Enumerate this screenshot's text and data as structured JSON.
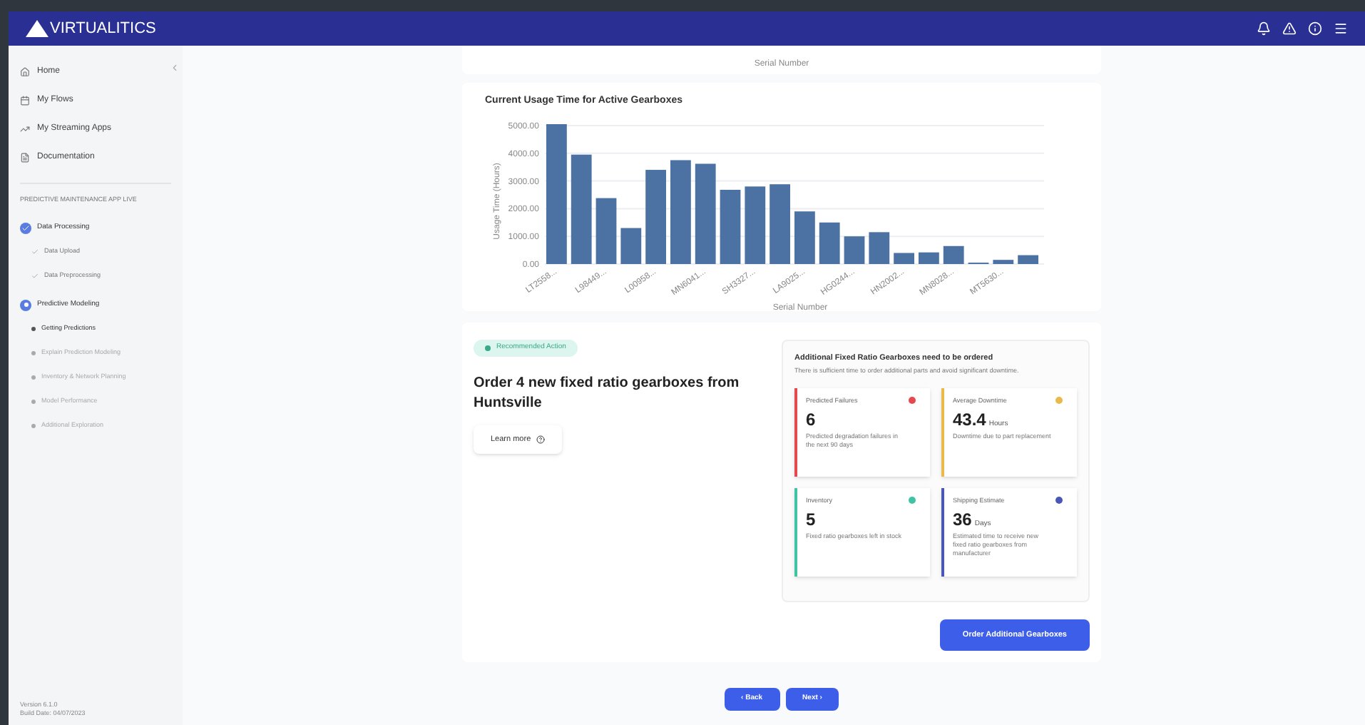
{
  "header": {
    "brand": "VIRTUALITICS"
  },
  "sidebar": {
    "nav": [
      {
        "label": "Home"
      },
      {
        "label": "My Flows"
      },
      {
        "label": "My Streaming Apps"
      },
      {
        "label": "Documentation"
      }
    ],
    "section_title": "PREDICTIVE MAINTENANCE APP LIVE",
    "steps": [
      {
        "label": "Data Processing",
        "done": true,
        "children": [
          {
            "label": "Data Upload",
            "selected": false,
            "done": true
          },
          {
            "label": "Data Preprocessing",
            "selected": false,
            "done": true
          }
        ]
      },
      {
        "label": "Predictive Modeling",
        "done": false,
        "children": [
          {
            "label": "Getting Predictions",
            "selected": true,
            "done": false
          },
          {
            "label": "Explain Prediction Modeling",
            "selected": false,
            "done": false
          },
          {
            "label": "Inventory & Network Planning",
            "selected": false,
            "done": false
          },
          {
            "label": "Model Performance",
            "selected": false,
            "done": false
          },
          {
            "label": "Additional Exploration",
            "selected": false,
            "done": false
          }
        ]
      }
    ],
    "footer": [
      "Version 6.1.0",
      "Build Date: 04/07/2023"
    ]
  },
  "previous_chart": {
    "xlabel": "Serial Number"
  },
  "usage_chart": {
    "chart_data": {
      "type": "bar",
      "title": "Current Usage Time for Active Gearboxes",
      "xlabel": "Serial Number",
      "ylabel": "Usage Time (Hours)",
      "categories": [
        "LT2558...",
        null,
        "L98449...",
        null,
        "L00958...",
        null,
        "MN6041...",
        null,
        "SH3327...",
        null,
        "LA9025...",
        null,
        "HG0244...",
        null,
        "HN2002...",
        null,
        "MN8028...",
        null,
        "MT5630...",
        null
      ],
      "grid": true,
      "ylim": [
        0,
        5050
      ],
      "series": [
        {
          "color": "#4c72a4",
          "values": [
            5050,
            3950,
            2380,
            1300,
            3400,
            3750,
            3620,
            2680,
            2800,
            2880,
            1900,
            1500,
            1000,
            1150,
            400,
            420,
            650,
            50,
            150,
            320
          ]
        }
      ],
      "yticks": [
        {
          "value": 0,
          "label": "0.00"
        },
        {
          "value": 1000,
          "label": "1000.00"
        },
        {
          "value": 2000,
          "label": "2000.00"
        },
        {
          "value": 3000,
          "label": "3000.00"
        },
        {
          "value": 4000,
          "label": "4000.00"
        },
        {
          "value": 5000,
          "label": "5000.00"
        }
      ]
    }
  },
  "recommendation": {
    "badge": "Recommended Action",
    "title": "Order 4 new fixed ratio gearboxes from Huntsville",
    "learn_more": "Learn more",
    "panel_title": "Additional Fixed Ratio Gearboxes need to be ordered",
    "panel_text": "There is sufficient time to order additional parts and avoid significant downtime.",
    "metrics": [
      {
        "label": "Predicted Failures",
        "value": "6",
        "description": "Predicted degradation failures in the next 90 days",
        "color": "#e5484d"
      },
      {
        "label": "Average Downtime",
        "value": "43.4",
        "unit": "Hours",
        "description": "Downtime due to part replacement",
        "color": "#e9b949"
      },
      {
        "label": "Inventory",
        "value": "5",
        "description": "Fixed ratio gearboxes left in stock",
        "color": "#3ec4a4"
      },
      {
        "label": "Shipping Estimate",
        "value": "36",
        "unit": "Days",
        "description": "Estimated time to receive new fixed ratio gearboxes from manufacturer",
        "color": "#4b57b8"
      }
    ],
    "order_button": "Order Additional Gearboxes"
  },
  "pager": {
    "back": "‹ Back",
    "next": "Next ›"
  }
}
